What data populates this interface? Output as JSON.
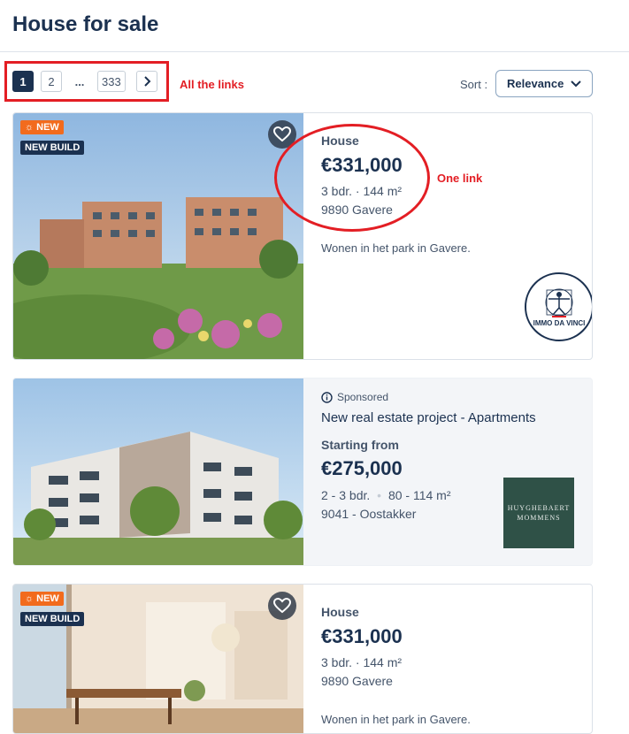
{
  "page": {
    "title": "House for sale"
  },
  "pagination": {
    "pages": [
      "1",
      "2",
      "...",
      "333"
    ],
    "active": "1"
  },
  "annotations": {
    "all_links": "All the links",
    "one_link": "One link"
  },
  "sort": {
    "label": "Sort :",
    "value": "Relevance"
  },
  "listings": [
    {
      "badge_new": "NEW",
      "badge_build": "NEW BUILD",
      "type": "House",
      "price": "€331,000",
      "specs": "3 bdr. · 144 m²",
      "location": "9890 Gavere",
      "description": "Wonen in het park in Gavere.",
      "agency": "IMMO DA VINCI"
    },
    {
      "sponsored": "Sponsored",
      "title": "New real estate project - Apartments",
      "type": "Starting from",
      "price": "€275,000",
      "specs_bedrooms": "2 - 3 bdr.",
      "specs_area": "80 - 114 m²",
      "location": "9041 - Oostakker",
      "agency_line1": "HUYGHEBAERT",
      "agency_line2": "MOMMENS"
    },
    {
      "badge_new": "NEW",
      "badge_build": "NEW BUILD",
      "type": "House",
      "price": "€331,000",
      "specs": "3 bdr. · 144 m²",
      "location": "9890 Gavere",
      "description": "Wonen in het park in Gavere."
    }
  ],
  "colors": {
    "primary": "#1b3150",
    "accent_new": "#f26b1d",
    "annotation": "#e31e24"
  }
}
